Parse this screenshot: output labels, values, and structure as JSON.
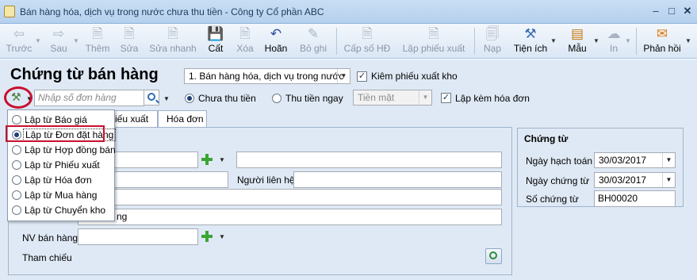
{
  "window": {
    "title": "Bán hàng hóa, dịch vụ trong nước chưa thu tiền - Công ty Cổ phần ABC",
    "minimize_icon": "minimize-icon",
    "maximize_icon": "maximize-icon",
    "close_icon": "close-icon"
  },
  "toolbar": {
    "prev": "Trước",
    "next": "Sau",
    "add": "Thêm",
    "edit": "Sửa",
    "quick_edit": "Sửa nhanh",
    "save": "Cất",
    "delete": "Xóa",
    "undo": "Hoãn",
    "unpost": "Bỏ ghi",
    "issue_invoice_no": "Cấp số HĐ",
    "create_delivery_note": "Lập phiếu xuất",
    "load": "Nạp",
    "utilities": "Tiện ích",
    "template": "Mẫu",
    "print": "In",
    "feedback": "Phản hồi"
  },
  "form": {
    "heading": "Chứng từ bán hàng",
    "type_select": "1. Bán hàng hóa, dịch vụ trong nước",
    "check_delivery_note": "Kiêm phiếu xuất kho",
    "order_search_placeholder": "Nhập số đơn hàng",
    "unpaid_radio": "Chưa thu tiền",
    "paid_now_radio": "Thu tiền ngay",
    "payment_method": "Tiền mặt",
    "with_invoice": "Lập kèm hóa đơn"
  },
  "tabs": [
    {
      "label_before": "",
      "label_partial": "iếu xuất",
      "underline": "x"
    },
    {
      "label": "Hóa đơn",
      "underline": "H"
    }
  ],
  "fields": {
    "contact_person_label": "Người liên hệ",
    "address_partial": "ng",
    "sales_staff_label": "NV bán hàng",
    "reference_label": "Tham chiếu"
  },
  "voucher": {
    "group_title": "Chứng từ",
    "posting_date_label": "Ngày hạch toán",
    "posting_date": "30/03/2017",
    "voucher_date_label": "Ngày chứng từ",
    "voucher_date": "30/03/2017",
    "voucher_no_label": "Số chứng từ",
    "voucher_no": "BH00020"
  },
  "menu": {
    "items": [
      "Lập từ Báo giá",
      "Lập từ Đơn đặt hàng",
      "Lập từ Hợp đồng bán",
      "Lập từ Phiếu xuất",
      "Lập từ Hóa đơn",
      "Lập từ Mua hàng",
      "Lập từ Chuyển kho"
    ],
    "selected_index": 1
  },
  "colors": {
    "highlight": "#c8102e",
    "panel_bg": "#dfe9f5",
    "title_text": "#1e395b"
  }
}
